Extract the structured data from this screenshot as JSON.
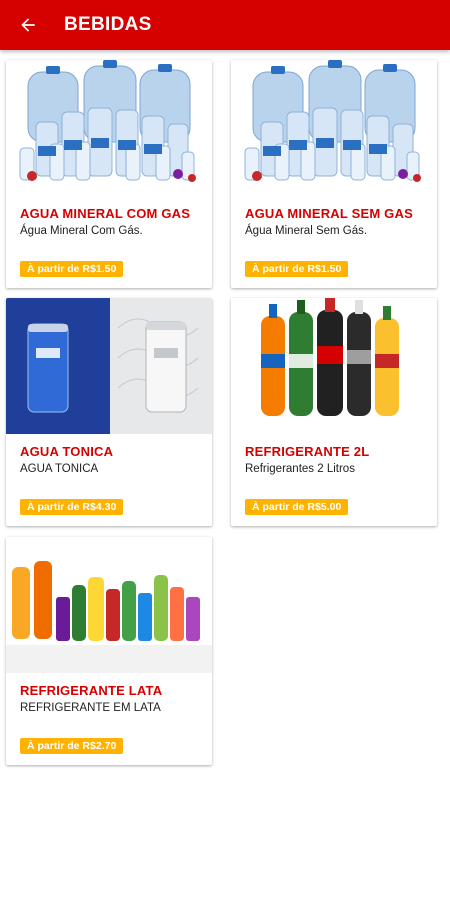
{
  "header": {
    "title": "BEBIDAS",
    "back_icon": "arrow-left-icon"
  },
  "colors": {
    "primary": "#d50000",
    "badge": "#ffb300"
  },
  "products": [
    {
      "title": "AGUA MINERAL COM GAS",
      "description": "Água Mineral Com Gás.",
      "price": "À partir de R$1.50",
      "image": "water-bottles-image"
    },
    {
      "title": "AGUA MINERAL SEM GAS",
      "description": "Água Mineral Sem Gás.",
      "price": "À partir de R$1.50",
      "image": "water-bottles-image"
    },
    {
      "title": "AGUA TONICA",
      "description": "AGUA TONICA",
      "price": "À partir de R$4.30",
      "image": "tonic-cans-image"
    },
    {
      "title": "REFRIGERANTE 2L",
      "description": "Refrigerantes 2 Litros",
      "price": "À partir de R$5.00",
      "image": "soda-bottles-image"
    },
    {
      "title": "REFRIGERANTE LATA",
      "description": "REFRIGERANTE EM LATA",
      "price": "À partir de R$2.70",
      "image": "soda-assortment-image"
    }
  ]
}
